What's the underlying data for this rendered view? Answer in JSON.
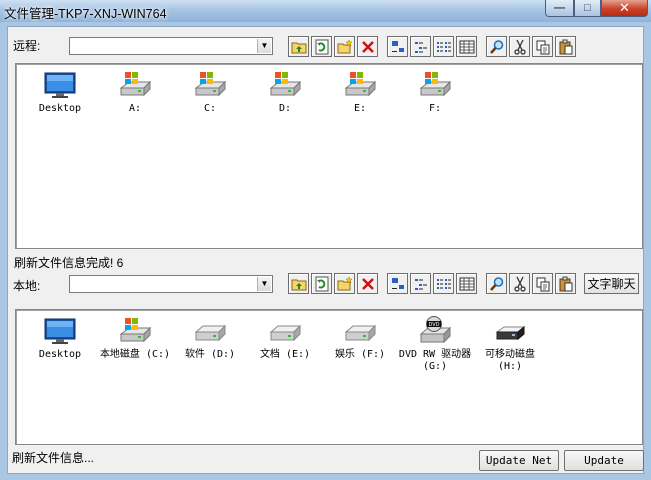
{
  "window": {
    "title": "文件管理-TKP7-XNJ-WIN764",
    "min_glyph": "—",
    "max_glyph": "□",
    "close_glyph": "✕"
  },
  "remote": {
    "label": "远程:",
    "path_value": "",
    "items": [
      {
        "label": "Desktop",
        "icon": "desktop-icon"
      },
      {
        "label": "A:",
        "icon": "drive-windows-icon"
      },
      {
        "label": "C:",
        "icon": "drive-windows-icon"
      },
      {
        "label": "D:",
        "icon": "drive-windows-icon"
      },
      {
        "label": "E:",
        "icon": "drive-windows-icon"
      },
      {
        "label": "F:",
        "icon": "drive-windows-icon"
      }
    ],
    "status": "刷新文件信息完成! 6"
  },
  "local": {
    "label": "本地:",
    "path_value": "",
    "chat_button": "文字聊天",
    "items": [
      {
        "label": "Desktop",
        "icon": "desktop-icon"
      },
      {
        "label": "本地磁盘 (C:)",
        "icon": "drive-windows-icon"
      },
      {
        "label": "软件 (D:)",
        "icon": "hard-drive-icon"
      },
      {
        "label": "文档 (E:)",
        "icon": "hard-drive-icon"
      },
      {
        "label": "娱乐 (F:)",
        "icon": "hard-drive-icon"
      },
      {
        "label": "DVD RW 驱动器 (G:)",
        "icon": "dvd-drive-icon"
      },
      {
        "label": "可移动磁盘 (H:)",
        "icon": "removable-drive-icon"
      }
    ],
    "status": "刷新文件信息...",
    "update_net_button": "Update Net",
    "update_button": "Update"
  },
  "toolbar_icons": [
    "up-folder-icon",
    "refresh-icon",
    "new-folder-icon",
    "delete-icon",
    "large-icons-view-icon",
    "small-icons-view-icon",
    "list-view-icon",
    "details-view-icon",
    "search-icon",
    "cut-icon",
    "copy-icon",
    "paste-icon"
  ]
}
